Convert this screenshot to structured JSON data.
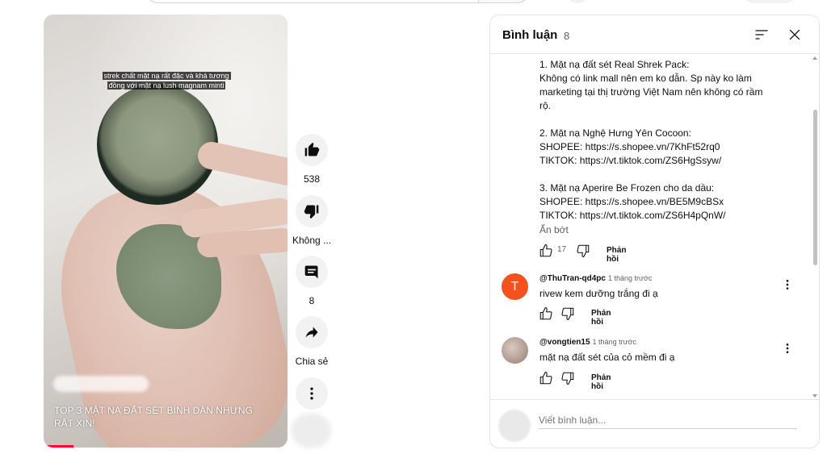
{
  "video": {
    "caption": "strek chất mặt nạ rất đặc và khá tương đồng với mặt nạ lush magnam minti",
    "title": "TOP 3 MẶT NẠ ĐẤT SÉT BÌNH DÂN NHƯNG RẤT XỊN!",
    "progress_fraction": 0.11
  },
  "actions": {
    "like_count": "538",
    "dislike_label": "Không ...",
    "comment_count": "8",
    "share_label": "Chia sẻ"
  },
  "comments_panel": {
    "title": "Bình luận",
    "count": "8",
    "reply_block": {
      "lines": [
        "1. Mặt nạ đất sét Real Shrek Pack:\nKhông có link mall nên em ko dẫn. Sp này ko làm marketing tại thị trường Việt Nam nên không có rầm rộ.",
        "2. Mặt nạ Nghệ Hưng Yên Cocoon:\nSHOPEE: https://s.shopee.vn/7KhFt52rq0\nTIKTOK: https://vt.tiktok.com/ZS6HgSsyw/",
        "3. Mặt nạ Aperire Be Frozen cho da dầu:\nSHOPEE: https://s.shopee.vn/BE5M9cBSx\nTIKTOK: https://vt.tiktok.com/ZS6H4pQnW/"
      ],
      "collapse_label": "Ẩn bớt",
      "like_count": "17",
      "reply_label": "Phản hồi"
    },
    "comments": [
      {
        "avatar_letter": "T",
        "author": "@ThuTran-qd4pc",
        "time": "1 tháng trước",
        "text": "rivew kem dưỡng trắng đi ạ",
        "reply_label": "Phản hồi"
      },
      {
        "avatar_letter": "",
        "author": "@vongtien15",
        "time": "1 tháng trước",
        "text": "mặt nạ đất sét của cỏ mềm đi ạ",
        "reply_label": "Phản hồi"
      }
    ],
    "input_placeholder": "Viết bình luận..."
  },
  "colors": {
    "accent_red": "#ff0033",
    "avatar_orange": "#f4511e",
    "button_bg": "#f2f2f2"
  }
}
